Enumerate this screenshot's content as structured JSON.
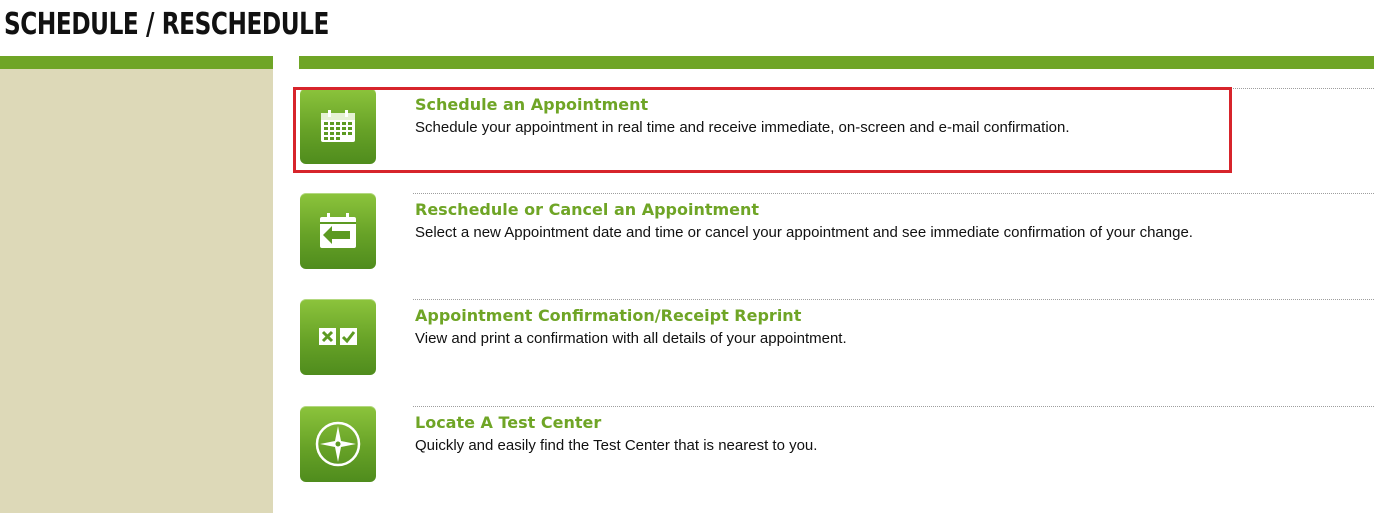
{
  "header": {
    "title": "Schedule / Reschedule"
  },
  "options": [
    {
      "title": "Schedule an Appointment",
      "description": "Schedule your appointment in real time and receive immediate, on-screen and e-mail confirmation.",
      "icon": "calendar-icon"
    },
    {
      "title": "Reschedule or Cancel an Appointment",
      "description": "Select a new Appointment date and time or cancel your appointment and see immediate confirmation of your change.",
      "icon": "calendar-arrow-icon"
    },
    {
      "title": "Appointment Confirmation/Receipt Reprint",
      "description": "View and print a confirmation with all details of your appointment.",
      "icon": "checkbox-icon"
    },
    {
      "title": "Locate A Test Center",
      "description": "Quickly and easily find the Test Center that is nearest to you.",
      "icon": "compass-icon"
    }
  ],
  "colors": {
    "accent_green": "#6fa526",
    "sidebar": "#ddd9b8",
    "highlight": "#d7242b"
  },
  "highlighted_option": "Schedule an Appointment"
}
